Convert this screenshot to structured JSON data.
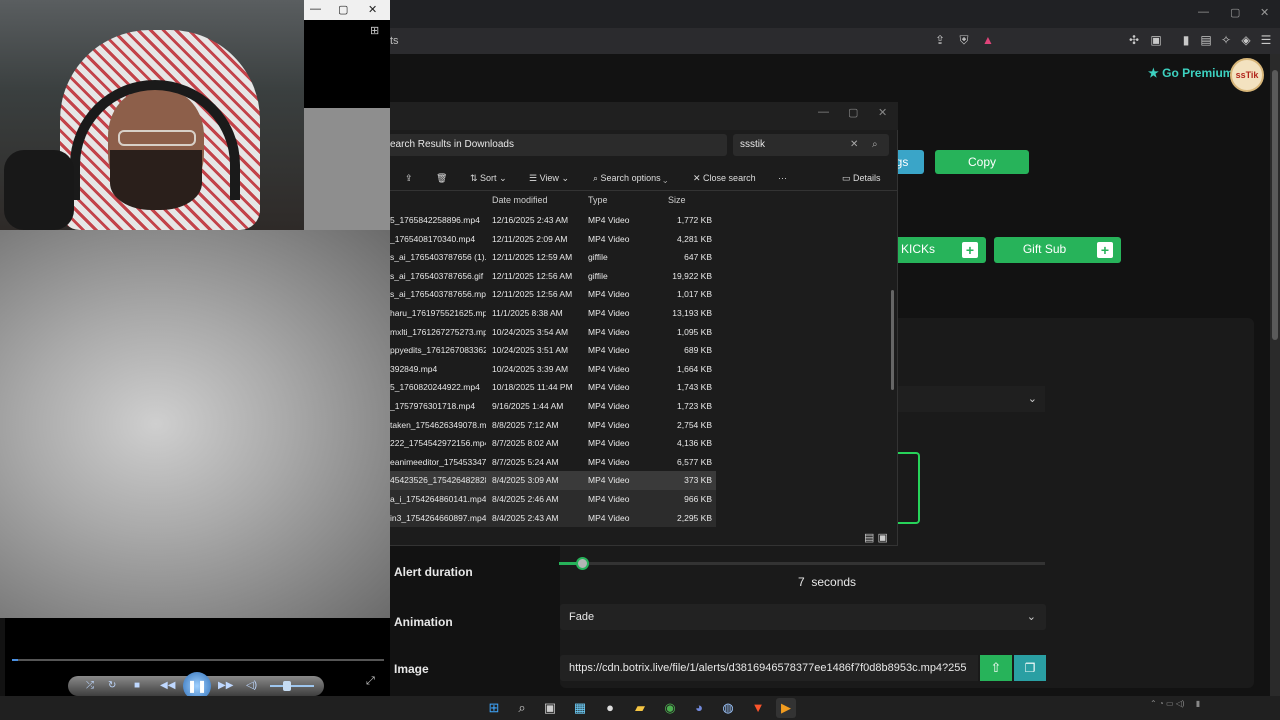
{
  "browser": {
    "address_text": "ts",
    "window_controls": [
      "—",
      "▢",
      "✕"
    ]
  },
  "page": {
    "premium_label": "Go Premium",
    "premium_icon": "star-icon",
    "avatar_text": "ssTik",
    "settings_btn": "gs",
    "copy_btn": "Copy",
    "kicks_btn": "KICKs",
    "giftsub_btn": "Gift Sub",
    "alert_duration_label": "Alert duration",
    "duration_value": "7",
    "duration_unit": "seconds",
    "slider_value": 7,
    "animation_label": "Animation",
    "animation_value": "Fade",
    "image_label": "Image",
    "image_url": "https://cdn.botrix.live/file/1/alerts/d3816946578377ee1486f7f0d8b8953c.mp4?255",
    "accent": "#27b35a",
    "secondary_accent": "#3aa5c8"
  },
  "explorer": {
    "path": "earch Results in Downloads",
    "search_value": "ssstik",
    "toolbar": {
      "sort": "Sort",
      "view": "View",
      "search_options": "Search options",
      "close_search": "Close search",
      "more": "···",
      "details": "Details"
    },
    "columns": {
      "date": "Date modified",
      "type": "Type",
      "size": "Size"
    },
    "rows": [
      {
        "name": "5_1765842258896.mp4",
        "date": "12/16/2025 2:43 AM",
        "type": "MP4 Video",
        "size": "1,772 KB"
      },
      {
        "name": "_1765408170340.mp4",
        "date": "12/11/2025 2:09 AM",
        "type": "MP4 Video",
        "size": "4,281 KB"
      },
      {
        "name": "s_ai_1765403787656 (1).gif",
        "date": "12/11/2025 12:59 AM",
        "type": "giffile",
        "size": "647 KB"
      },
      {
        "name": "s_ai_1765403787656.gif",
        "date": "12/11/2025 12:56 AM",
        "type": "giffile",
        "size": "19,922 KB"
      },
      {
        "name": "s_ai_1765403787656.mp4",
        "date": "12/11/2025 12:56 AM",
        "type": "MP4 Video",
        "size": "1,017 KB"
      },
      {
        "name": "haru_1761975521625.mp4",
        "date": "11/1/2025 8:38 AM",
        "type": "MP4 Video",
        "size": "13,193 KB"
      },
      {
        "name": "mxlti_1761267275273.mp4",
        "date": "10/24/2025 3:54 AM",
        "type": "MP4 Video",
        "size": "1,095 KB"
      },
      {
        "name": "ppyedits_1761267083362....",
        "date": "10/24/2025 3:51 AM",
        "type": "MP4 Video",
        "size": "689 KB"
      },
      {
        "name": "392849.mp4",
        "date": "10/24/2025 3:39 AM",
        "type": "MP4 Video",
        "size": "1,664 KB"
      },
      {
        "name": "5_1760820244922.mp4",
        "date": "10/18/2025 11:44 PM",
        "type": "MP4 Video",
        "size": "1,743 KB"
      },
      {
        "name": "_1757976301718.mp4",
        "date": "9/16/2025 1:44 AM",
        "type": "MP4 Video",
        "size": "1,723 KB"
      },
      {
        "name": "taken_1754626349078.mp4",
        "date": "8/8/2025 7:12 AM",
        "type": "MP4 Video",
        "size": "2,754 KB"
      },
      {
        "name": "222_1754542972156.mp4",
        "date": "8/7/2025 8:02 AM",
        "type": "MP4 Video",
        "size": "4,136 KB"
      },
      {
        "name": "eanimeeditor_175453347...",
        "date": "8/7/2025 5:24 AM",
        "type": "MP4 Video",
        "size": "6,577 KB"
      },
      {
        "name": "45423526_1754264828288...",
        "date": "8/4/2025 3:09 AM",
        "type": "MP4 Video",
        "size": "373 KB"
      },
      {
        "name": "a_i_1754264860141.mp4",
        "date": "8/4/2025 2:46 AM",
        "type": "MP4 Video",
        "size": "966 KB"
      },
      {
        "name": "in3_1754264660897.mp4",
        "date": "8/4/2025 2:43 AM",
        "type": "MP4 Video",
        "size": "2,295 KB"
      }
    ]
  },
  "player": {
    "progress": 0.02,
    "volume": 0.4
  },
  "taskbar": {
    "icons": [
      "windows-icon",
      "search-icon",
      "task-view-icon",
      "store-icon",
      "app-icon",
      "folder-icon",
      "chrome-icon",
      "discord-icon",
      "steam-icon",
      "brave-icon",
      "media-player-icon"
    ]
  }
}
